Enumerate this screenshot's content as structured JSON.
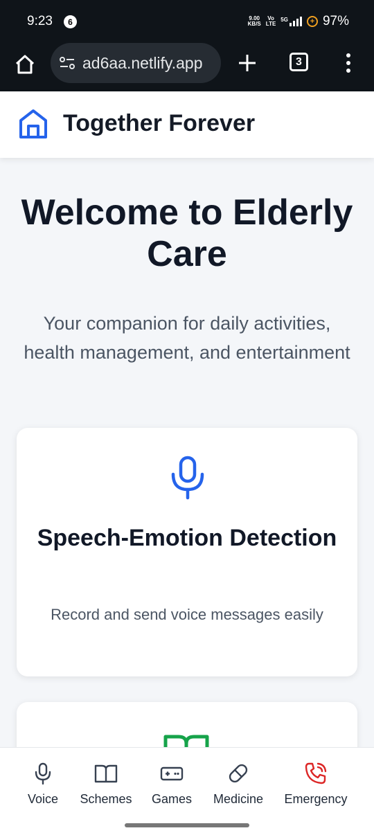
{
  "status": {
    "time": "9:23",
    "notification_count": "6",
    "net_speed_value": "9.00",
    "net_speed_unit": "KB/S",
    "volte_top": "Vo",
    "volte_bottom": "LTE",
    "network_type": "5G",
    "battery": "97%"
  },
  "browser": {
    "url": "ad6aa.netlify.app",
    "tab_count": "3"
  },
  "header": {
    "title": "Together Forever"
  },
  "hero": {
    "title": "Welcome to Elderly Care",
    "subtitle": "Your companion for daily activities, health management, and entertainment"
  },
  "cards": [
    {
      "icon": "microphone-icon",
      "title": "Speech-Emotion Detection",
      "description": "Record and send voice messages easily"
    },
    {
      "icon": "book-icon"
    }
  ],
  "nav": [
    {
      "label": "Voice",
      "icon": "microphone-icon"
    },
    {
      "label": "Schemes",
      "icon": "book-icon"
    },
    {
      "label": "Games",
      "icon": "gamepad-icon"
    },
    {
      "label": "Medicine",
      "icon": "pill-icon"
    },
    {
      "label": "Emergency",
      "icon": "phone-ringing-icon"
    }
  ],
  "colors": {
    "brand_blue": "#2563eb",
    "schemes_green": "#16a34a",
    "emergency_red": "#dc2626"
  }
}
